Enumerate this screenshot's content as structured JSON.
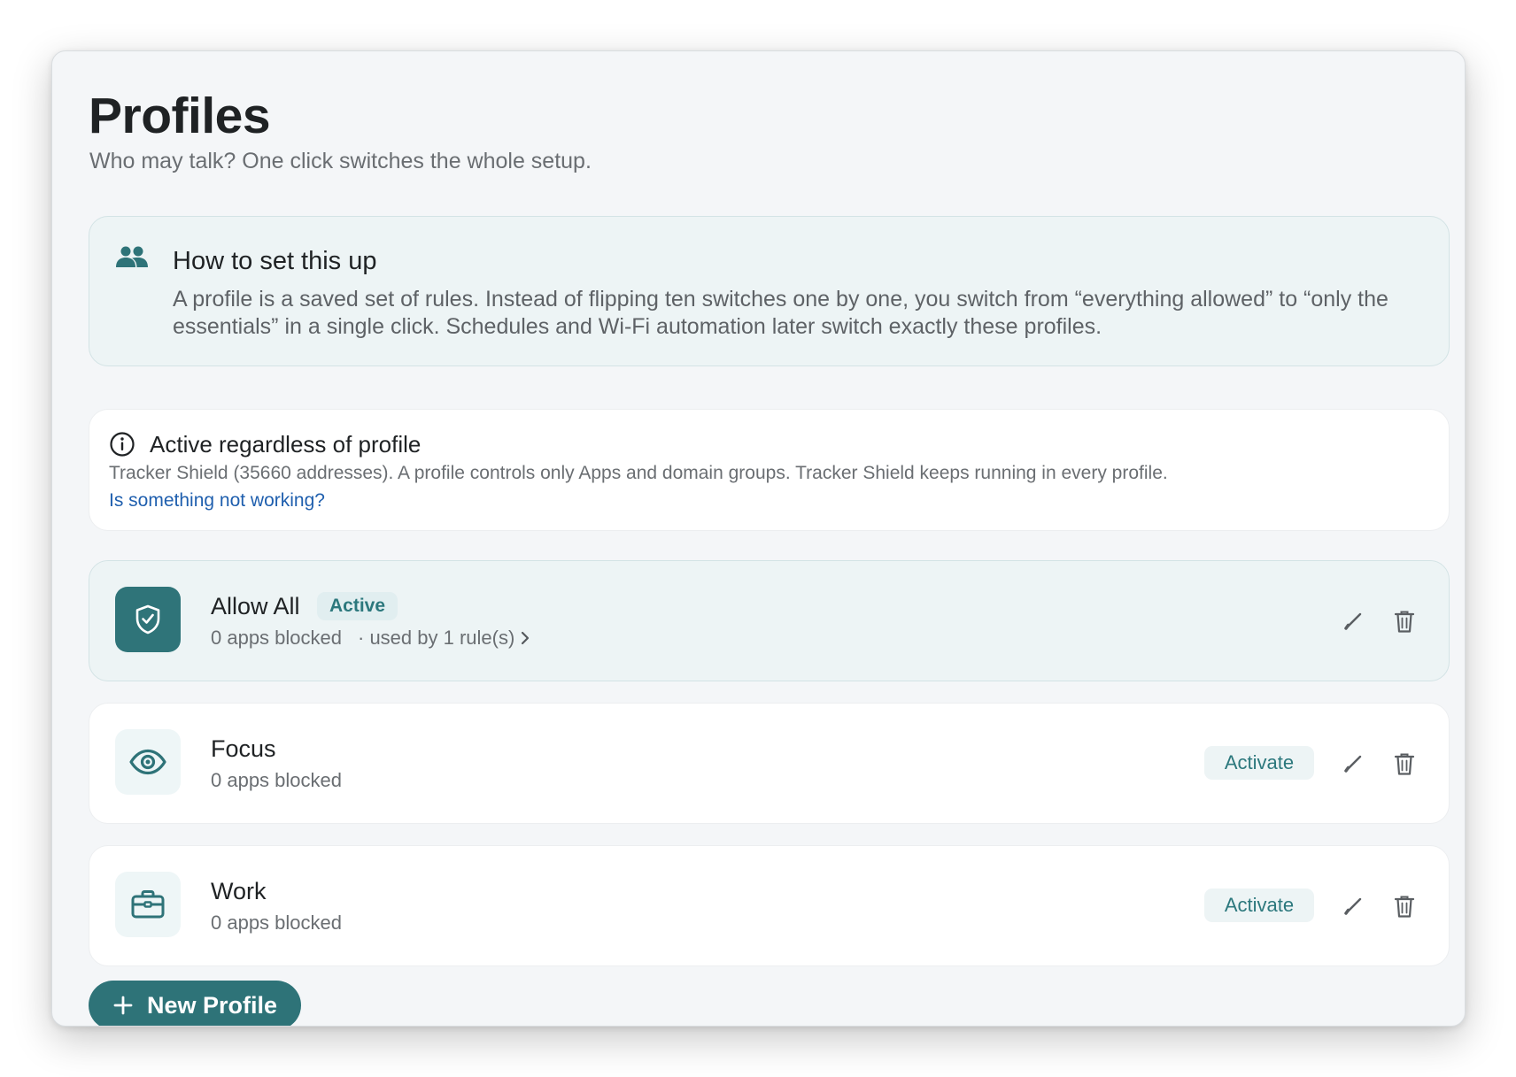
{
  "page": {
    "title": "Profiles",
    "subtitle": "Who may talk? One click switches the whole setup."
  },
  "help_card": {
    "icon": "people-icon",
    "title": "How to set this up",
    "body": "A profile is a saved set of rules. Instead of flipping ten switches one by one, you switch from “everything allowed” to “only the essentials” in a single click. Schedules and Wi-Fi automation later switch exactly these profiles."
  },
  "info_card": {
    "icon": "info-icon",
    "title": "Active regardless of profile",
    "body": "Tracker Shield (35660 addresses). A profile controls only Apps and domain groups. Tracker Shield keeps running in every profile.",
    "link": "Is something not working?"
  },
  "profiles": [
    {
      "name": "Allow All",
      "icon": "shield-check-icon",
      "active": true,
      "badge": "Active",
      "subtitle": "0 apps blocked",
      "usage": "· used by 1 rule(s)"
    },
    {
      "name": "Focus",
      "icon": "eye-icon",
      "active": false,
      "subtitle": "0 apps blocked",
      "action": "Activate"
    },
    {
      "name": "Work",
      "icon": "briefcase-icon",
      "active": false,
      "subtitle": "0 apps blocked",
      "action": "Activate"
    }
  ],
  "new_profile_button": "New Profile",
  "colors": {
    "accent": "#2e7378",
    "accent_text": "#2c787d",
    "link": "#1f5fae",
    "window_bg": "#f4f6f8",
    "active_card_bg": "#edf4f5"
  }
}
